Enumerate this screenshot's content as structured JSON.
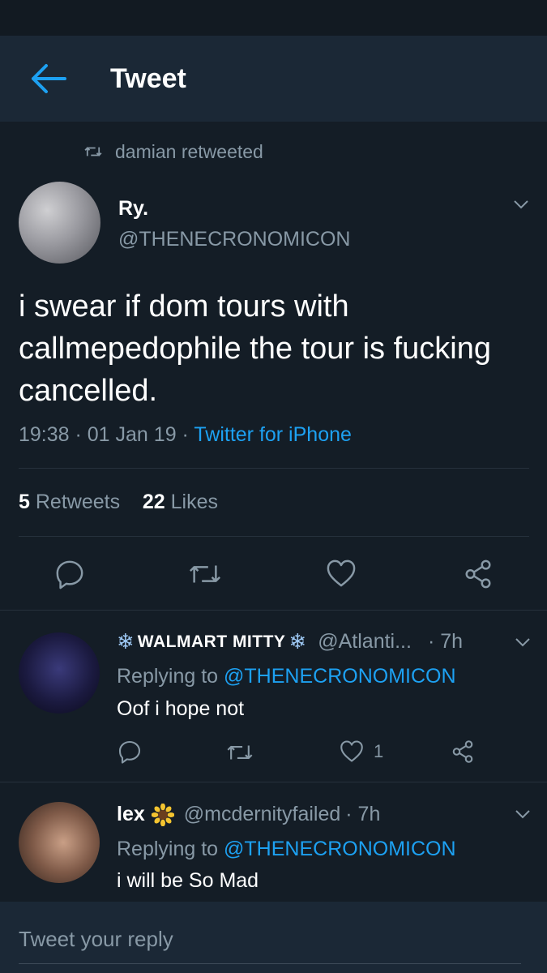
{
  "header": {
    "title": "Tweet"
  },
  "retweet": {
    "text": "damian retweeted"
  },
  "tweet": {
    "name": "Ry.",
    "handle": "@THENECRONOMICON",
    "text": "i swear if dom tours with callmepedophile the tour is fucking cancelled.",
    "time": "19:38 · 01 Jan 19 ·",
    "source": "Twitter for iPhone",
    "retweets_count": "5",
    "retweets_label": "Retweets",
    "likes_count": "22",
    "likes_label": "Likes"
  },
  "replies": [
    {
      "name": "WALMART MITTY",
      "handle": "@Atlanti...",
      "time": "· 7h",
      "replying_prefix": "Replying to",
      "replying_to": "@THENECRONOMICON",
      "text": "Oof i hope not",
      "like_count": "1"
    },
    {
      "name": "lex",
      "handle": "@mcdernityfailed",
      "time": "· 7h",
      "replying_prefix": "Replying to",
      "replying_to": "@THENECRONOMICON",
      "text": "i will be So Mad"
    }
  ],
  "compose": {
    "placeholder": "Tweet your reply"
  },
  "colors": {
    "background": "#141d26",
    "header": "#1b2836",
    "accent": "#1da1f2",
    "muted": "#8899a6"
  }
}
